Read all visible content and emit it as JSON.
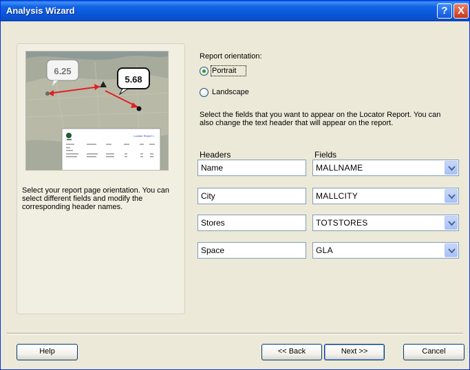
{
  "window": {
    "title": "Analysis Wizard",
    "help_button": "?",
    "close_button": "X"
  },
  "preview": {
    "callout_a": "6.25",
    "callout_b": "5.68",
    "report_title": "Locator Report 1"
  },
  "left_description": "Select your report page orientation. You can select different fields and modify the corresponding header names.",
  "orientation": {
    "label": "Report orientation:",
    "options": [
      {
        "label": "Portrait",
        "selected": true
      },
      {
        "label": "Landscape",
        "selected": false
      }
    ]
  },
  "fields_description": "Select the fields that you want to appear on the Locator Report. You can also change the text header that will appear on the report.",
  "columns": {
    "headers": "Headers",
    "fields": "Fields"
  },
  "rows": [
    {
      "header": "Name",
      "field": "MALLNAME"
    },
    {
      "header": "City",
      "field": "MALLCITY"
    },
    {
      "header": "Stores",
      "field": "TOTSTORES"
    },
    {
      "header": "Space",
      "field": "GLA"
    }
  ],
  "buttons": {
    "help": "Help",
    "back": "<< Back",
    "next": "Next >>",
    "cancel": "Cancel"
  },
  "colors": {
    "titlebar": "#0a56d9",
    "dialog_bg": "#ece9d8",
    "radio_dot": "#21a121",
    "arrow_red": "#e02020"
  }
}
